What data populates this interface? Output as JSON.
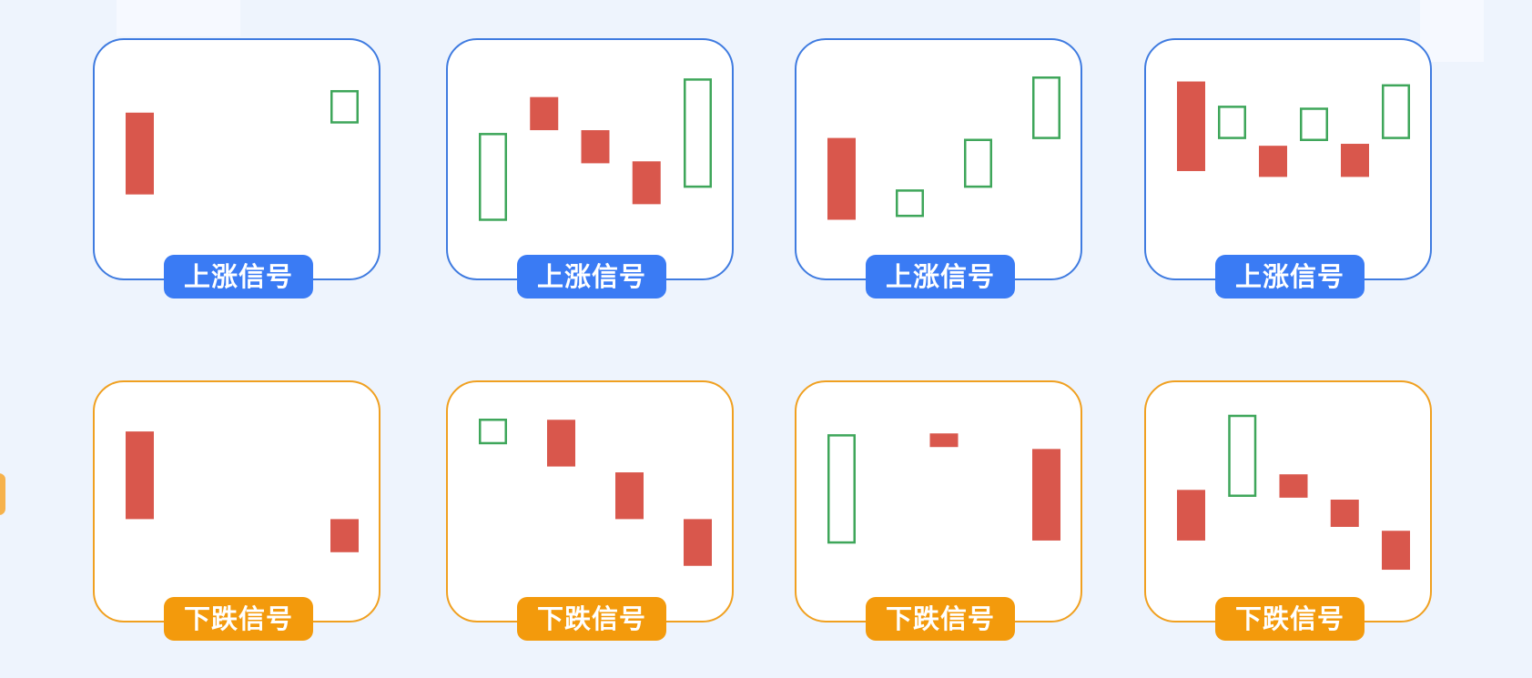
{
  "colors": {
    "up_border": "#3f7be0",
    "up_badge": "#3a7bf4",
    "down_border": "#f0a020",
    "down_badge": "#f39a0c",
    "filled_candle": "#d9574c",
    "hollow_candle": "#3ea65a"
  },
  "panels": [
    {
      "kind": "up",
      "label": "上涨信号",
      "candles": [
        {
          "style": "filled",
          "open": 0.31,
          "close": 0.73
        },
        {
          "style": "hollow",
          "open": 0.68,
          "close": 0.84
        }
      ]
    },
    {
      "kind": "up",
      "label": "上涨信号",
      "candles": [
        {
          "style": "hollow",
          "open": 0.18,
          "close": 0.62
        },
        {
          "style": "filled",
          "open": 0.64,
          "close": 0.81
        },
        {
          "style": "filled",
          "open": 0.47,
          "close": 0.64
        },
        {
          "style": "filled",
          "open": 0.26,
          "close": 0.48
        },
        {
          "style": "hollow",
          "open": 0.35,
          "close": 0.9
        }
      ]
    },
    {
      "kind": "up",
      "label": "上涨信号",
      "candles": [
        {
          "style": "filled",
          "open": 0.18,
          "close": 0.6
        },
        {
          "style": "hollow",
          "open": 0.2,
          "close": 0.33
        },
        {
          "style": "hollow",
          "open": 0.35,
          "close": 0.59
        },
        {
          "style": "hollow",
          "open": 0.6,
          "close": 0.91
        }
      ]
    },
    {
      "kind": "up",
      "label": "上涨信号",
      "candles": [
        {
          "style": "filled",
          "open": 0.43,
          "close": 0.89
        },
        {
          "style": "hollow",
          "open": 0.6,
          "close": 0.76
        },
        {
          "style": "filled",
          "open": 0.4,
          "close": 0.56
        },
        {
          "style": "hollow",
          "open": 0.59,
          "close": 0.75
        },
        {
          "style": "filled",
          "open": 0.4,
          "close": 0.57
        },
        {
          "style": "hollow",
          "open": 0.6,
          "close": 0.87
        }
      ]
    },
    {
      "kind": "down",
      "label": "下跌信号",
      "candles": [
        {
          "style": "filled",
          "open": 0.85,
          "close": 0.4
        },
        {
          "style": "filled",
          "open": 0.4,
          "close": 0.23
        }
      ]
    },
    {
      "kind": "down",
      "label": "下跌信号",
      "candles": [
        {
          "style": "hollow",
          "open": 0.79,
          "close": 0.91
        },
        {
          "style": "filled",
          "open": 0.91,
          "close": 0.67
        },
        {
          "style": "filled",
          "open": 0.64,
          "close": 0.4
        },
        {
          "style": "filled",
          "open": 0.4,
          "close": 0.16
        }
      ]
    },
    {
      "kind": "down",
      "label": "下跌信号",
      "candles": [
        {
          "style": "hollow",
          "open": 0.28,
          "close": 0.83
        },
        {
          "style": "filled",
          "open": 0.84,
          "close": 0.77
        },
        {
          "style": "filled",
          "open": 0.76,
          "close": 0.29
        }
      ]
    },
    {
      "kind": "down",
      "label": "下跌信号",
      "candles": [
        {
          "style": "filled",
          "open": 0.55,
          "close": 0.29
        },
        {
          "style": "hollow",
          "open": 0.52,
          "close": 0.93
        },
        {
          "style": "filled",
          "open": 0.63,
          "close": 0.51
        },
        {
          "style": "filled",
          "open": 0.5,
          "close": 0.36
        },
        {
          "style": "filled",
          "open": 0.34,
          "close": 0.14
        }
      ]
    }
  ]
}
